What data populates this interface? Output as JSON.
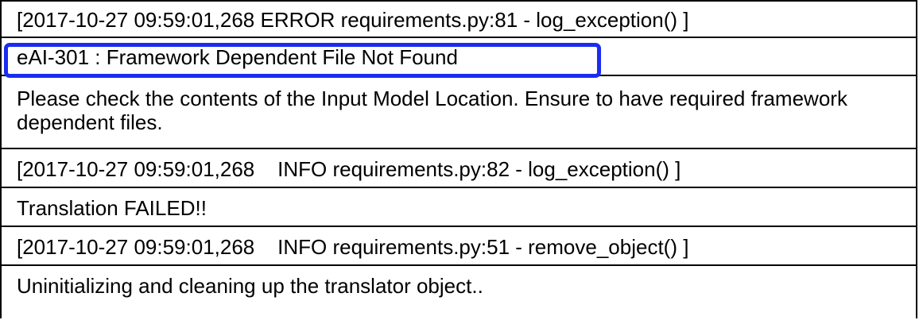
{
  "log": {
    "lines": [
      "[2017-10-27 09:59:01,268 ERROR requirements.py:81 - log_exception() ]",
      "eAI-301 : Framework Dependent File Not Found",
      "Please check the contents of the Input Model Location. Ensure to have required framework dependent files.",
      "[2017-10-27 09:59:01,268    INFO requirements.py:82 - log_exception() ]",
      "Translation FAILED!!",
      "[2017-10-27 09:59:01,268    INFO requirements.py:51 - remove_object() ]",
      "Uninitializing and cleaning up the translator object.."
    ]
  },
  "colors": {
    "highlight": "#1a2cf0",
    "border": "#000000"
  }
}
